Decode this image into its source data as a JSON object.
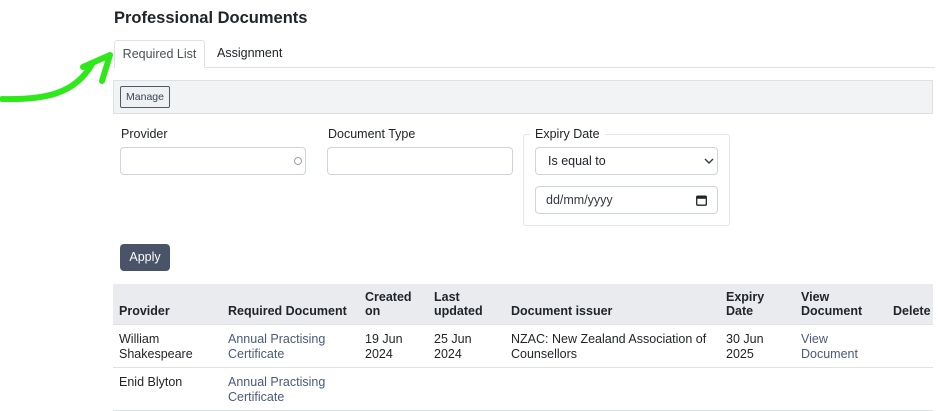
{
  "page": {
    "title": "Professional Documents"
  },
  "tabs": [
    {
      "label": "Required List",
      "active": true
    },
    {
      "label": "Assignment",
      "active": false
    }
  ],
  "toolbar": {
    "manage_label": "Manage"
  },
  "filters": {
    "provider_label": "Provider",
    "provider_value": "",
    "document_type_label": "Document Type",
    "document_type_value": "",
    "expiry_legend": "Expiry Date",
    "expiry_operator": "Is equal to",
    "expiry_date_placeholder": "dd/mm/yyyy",
    "apply_label": "Apply"
  },
  "table": {
    "headers": {
      "provider": "Provider",
      "required_document": "Required Document",
      "created_on": "Created on",
      "last_updated": "Last updated",
      "document_issuer": "Document issuer",
      "expiry_date": "Expiry Date",
      "view_document": "View Document",
      "delete": "Delete"
    },
    "rows": [
      {
        "provider": "William Shakespeare",
        "required_document": "Annual Practising Certificate",
        "created_on": "19 Jun 2024",
        "last_updated": "25 Jun 2024",
        "document_issuer": "NZAC: New Zealand Association of Counsellors",
        "expiry_date": "30 Jun 2025",
        "view_document": "View Document",
        "delete": ""
      },
      {
        "provider": "Enid Blyton",
        "required_document": "Annual Practising Certificate",
        "created_on": "",
        "last_updated": "",
        "document_issuer": "",
        "expiry_date": "",
        "view_document": "",
        "delete": ""
      }
    ]
  },
  "colors": {
    "annotation_arrow": "#2ee81a",
    "primary_button": "#4a5468",
    "link": "#4a5a78",
    "table_header_bg": "#e9ebef"
  },
  "icons": {
    "provider_field": "circle-icon",
    "expiry_select": "chevron-down-icon",
    "expiry_date": "calendar-icon"
  }
}
